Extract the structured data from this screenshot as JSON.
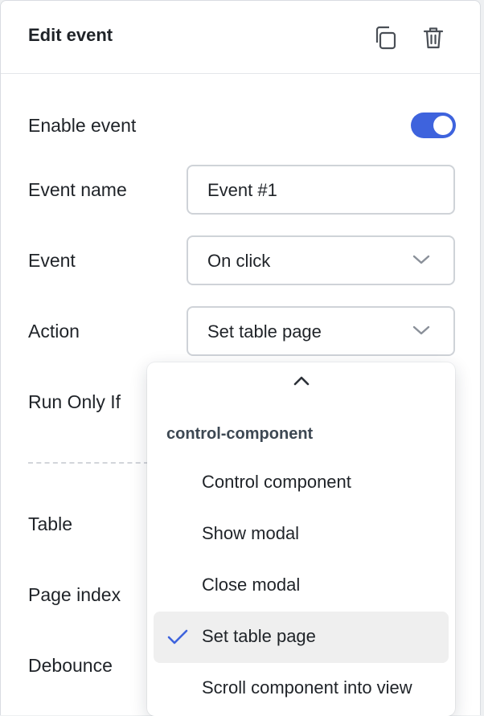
{
  "header": {
    "title": "Edit event"
  },
  "form": {
    "enable_label": "Enable event",
    "enable_on": true,
    "event_name_label": "Event name",
    "event_name_value": "Event #1",
    "event_label": "Event",
    "event_value": "On click",
    "action_label": "Action",
    "action_value": "Set table page",
    "run_only_if_label": "Run Only If",
    "table_label": "Table",
    "page_index_label": "Page index",
    "debounce_label": "Debounce"
  },
  "dropdown": {
    "group_label": "control-component",
    "options": [
      {
        "label": "Control component",
        "selected": false
      },
      {
        "label": "Show modal",
        "selected": false
      },
      {
        "label": "Close modal",
        "selected": false
      },
      {
        "label": "Set table page",
        "selected": true
      },
      {
        "label": "Scroll component into view",
        "selected": false
      }
    ]
  },
  "colors": {
    "accent": "#3e63dd",
    "selected_bg": "#efefef"
  },
  "icons": {
    "duplicate": "copy-icon",
    "delete": "trash-icon",
    "dropdown_arrow": "chevron-down-icon",
    "scroll_up": "chevron-up-icon",
    "selected_mark": "check-icon"
  }
}
